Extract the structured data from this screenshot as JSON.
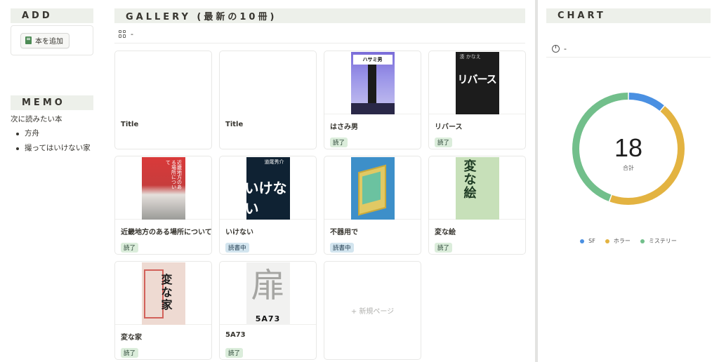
{
  "add": {
    "heading": "ADD",
    "button_label": "本を追加"
  },
  "memo": {
    "heading": "MEMO",
    "title": "次に読みたい本",
    "items": [
      "方舟",
      "撮ってはいけない家"
    ]
  },
  "gallery": {
    "heading": "GALLERY (最新の10冊)",
    "view_label": "-",
    "new_page_label": "+ 新規ページ",
    "books": [
      {
        "title": "Title",
        "status": "",
        "cover": "empty"
      },
      {
        "title": "Title",
        "status": "",
        "cover": "empty"
      },
      {
        "title": "はさみ男",
        "status": "読了",
        "cover": "hasami"
      },
      {
        "title": "リバース",
        "status": "読了",
        "cover": "reverse"
      },
      {
        "title": "近畿地方のある場所について",
        "status": "読了",
        "cover": "kinki"
      },
      {
        "title": "いけない",
        "status": "読書中",
        "cover": "ikenai"
      },
      {
        "title": "不器用で",
        "status": "読書中",
        "cover": "bukiyo"
      },
      {
        "title": "変な絵",
        "status": "読了",
        "cover": "hen-e"
      },
      {
        "title": "変な家",
        "status": "読了",
        "cover": "hen-ie"
      },
      {
        "title": "5A73",
        "status": "読了",
        "cover": "5a73"
      }
    ],
    "cover_text": {
      "hasami_label": "ハサミ男",
      "reverse_title": "リバース",
      "reverse_author": "湊 かなえ",
      "kinki_title": "近畿地方のある場所について",
      "ikenai_title": "いけない",
      "ikenai_author": "道尾秀介",
      "hen_e_title": "変な絵",
      "hen_ie_title": "変な家",
      "s5a73_kanji": "扉",
      "s5a73_title": "5A73"
    }
  },
  "chart": {
    "heading": "CHART",
    "view_label": "-",
    "center_value": "18",
    "center_label": "合計"
  },
  "chart_data": {
    "type": "pie",
    "style": "donut",
    "total": 18,
    "categories": [
      "SF",
      "ホラー",
      "ミステリー"
    ],
    "values": [
      2,
      8,
      8
    ],
    "colors": [
      "#4a90e2",
      "#e3b341",
      "#72bf8b"
    ],
    "legend": "bottom"
  }
}
